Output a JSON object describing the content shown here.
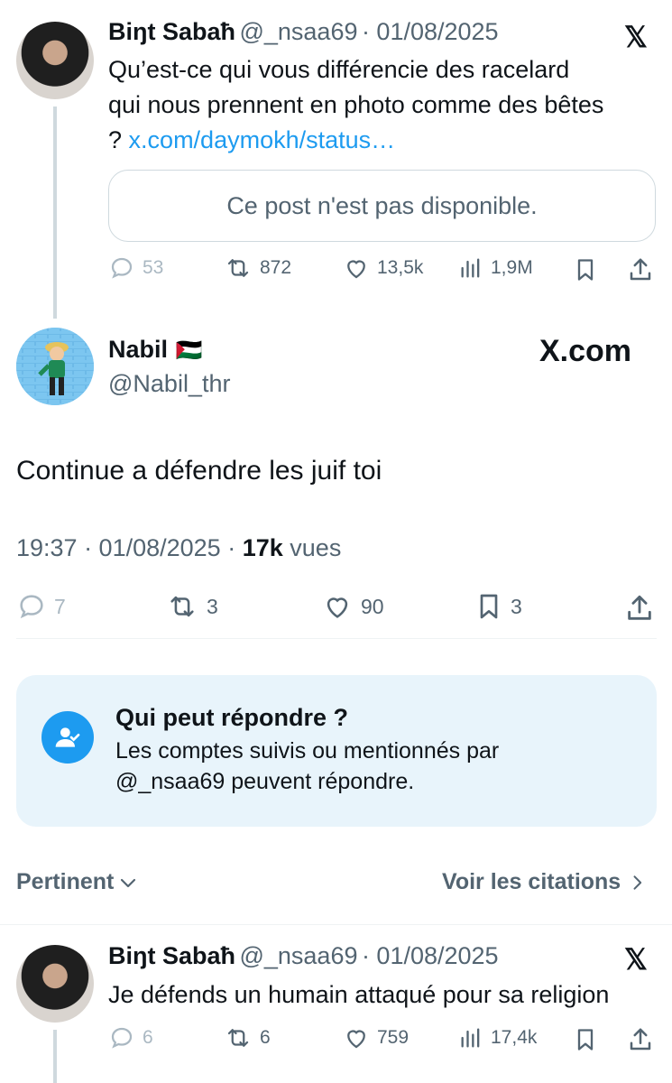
{
  "quoted_post": {
    "author_name": "Biŋt Sabaħ",
    "handle": "@_nsaa69",
    "date": "· 01/08/2025",
    "text_line1": "Qu’est-ce qui vous différencie des racelard",
    "text_line2": "qui nous prennent en photo comme des bêtes",
    "text_line3_prefix": "?",
    "link": "x.com/daymokh/status…",
    "unavailable": "Ce post n'est pas disponible.",
    "replies": "53",
    "reposts": "872",
    "likes": "13,5k",
    "views": "1,9M"
  },
  "main_post": {
    "author_name": "Nabil",
    "flag": "🇵🇸",
    "handle": "@Nabil_thr",
    "brand": "X.com",
    "text": "Continue a défendre les juif toi",
    "time": "19:37 · 01/08/2025 ·",
    "views_count": "17k",
    "views_label": "vues",
    "replies": "7",
    "reposts": "3",
    "likes": "90",
    "bookmarks": "3"
  },
  "reply_notice": {
    "title": "Qui peut répondre ?",
    "line1": "Les comptes suivis ou mentionnés par",
    "line2": "@_nsaa69 peuvent répondre."
  },
  "sort_bar": {
    "relevance": "Pertinent",
    "quotes": "Voir les citations"
  },
  "reply_post": {
    "author_name": "Biŋt Sabaħ",
    "handle": "@_nsaa69",
    "date": "· 01/08/2025",
    "text": "Je défends un humain attaqué pour sa religion",
    "replies": "6",
    "reposts": "6",
    "likes": "759",
    "views": "17,4k"
  },
  "colors": {
    "accent": "#1d9bf0",
    "text": "#0f1419",
    "muted": "#536471",
    "notice_bg": "#e8f4fb"
  }
}
